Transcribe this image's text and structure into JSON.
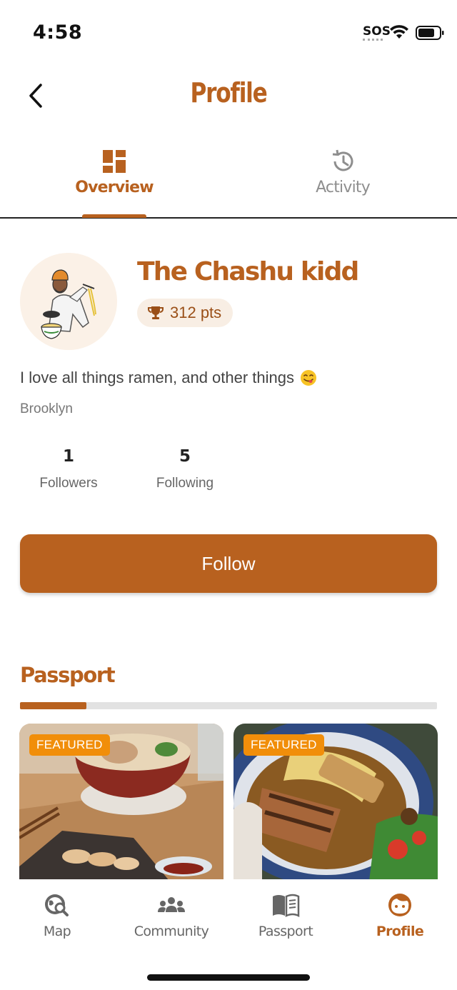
{
  "status_bar": {
    "time": "4:58",
    "sos": "SOS",
    "icons": [
      "wifi-icon",
      "battery-icon"
    ]
  },
  "header": {
    "title": "Profile",
    "back_icon": "chevron-left-icon"
  },
  "tabs": [
    {
      "label": "Overview",
      "icon": "dashboard-grid-icon",
      "active": true
    },
    {
      "label": "Activity",
      "icon": "history-icon",
      "active": false
    }
  ],
  "profile": {
    "name": "The Chashu kidd",
    "points": "312 pts",
    "points_icon": "trophy-icon",
    "bio": "I love all things ramen, and other things",
    "bio_emoji": "yum-face-emoji-icon",
    "location": "Brooklyn",
    "avatar": "avatar-illustration"
  },
  "stats": {
    "followers": {
      "count": "1",
      "label": "Followers"
    },
    "following": {
      "count": "5",
      "label": "Following"
    }
  },
  "follow_button": {
    "label": "Follow"
  },
  "passport": {
    "title": "Passport",
    "progress": 0.16,
    "cards": [
      {
        "badge": "FEATURED",
        "image": "ramen-bowl-with-dumplings-photo"
      },
      {
        "badge": "FEATURED",
        "image": "ramen-with-chashu-photo"
      }
    ]
  },
  "bottom_nav": [
    {
      "label": "Map",
      "icon": "map-search-icon",
      "active": false
    },
    {
      "label": "Community",
      "icon": "community-icon",
      "active": false
    },
    {
      "label": "Passport",
      "icon": "book-icon",
      "active": false
    },
    {
      "label": "Profile",
      "icon": "profile-face-icon",
      "active": true
    }
  ],
  "colors": {
    "accent": "#b8611f",
    "badge": "#f18e0a",
    "badge_bg": "#f8eee4"
  }
}
